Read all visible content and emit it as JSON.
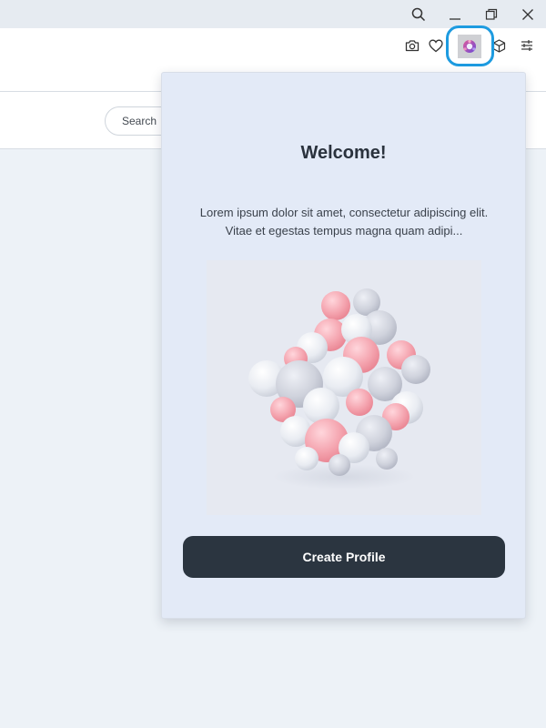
{
  "search": {
    "placeholder": "Search"
  },
  "popup": {
    "title": "Welcome!",
    "description": "Lorem ipsum dolor sit amet, consectetur adipiscing elit. Vitae et egestas tempus magna quam adipi...",
    "cta_label": "Create Profile"
  },
  "icons": {
    "titlebar": [
      "search-icon",
      "minimize-icon",
      "restore-icon",
      "close-icon"
    ],
    "toolbar": [
      "camera-icon",
      "heart-icon",
      "extension-icon",
      "cube-icon",
      "settings-sliders-icon"
    ]
  },
  "colors": {
    "highlight": "#1d9be0",
    "button_bg": "#2b3540",
    "popup_bg": "#e3eaf7",
    "page_bg": "#edf2f7"
  }
}
